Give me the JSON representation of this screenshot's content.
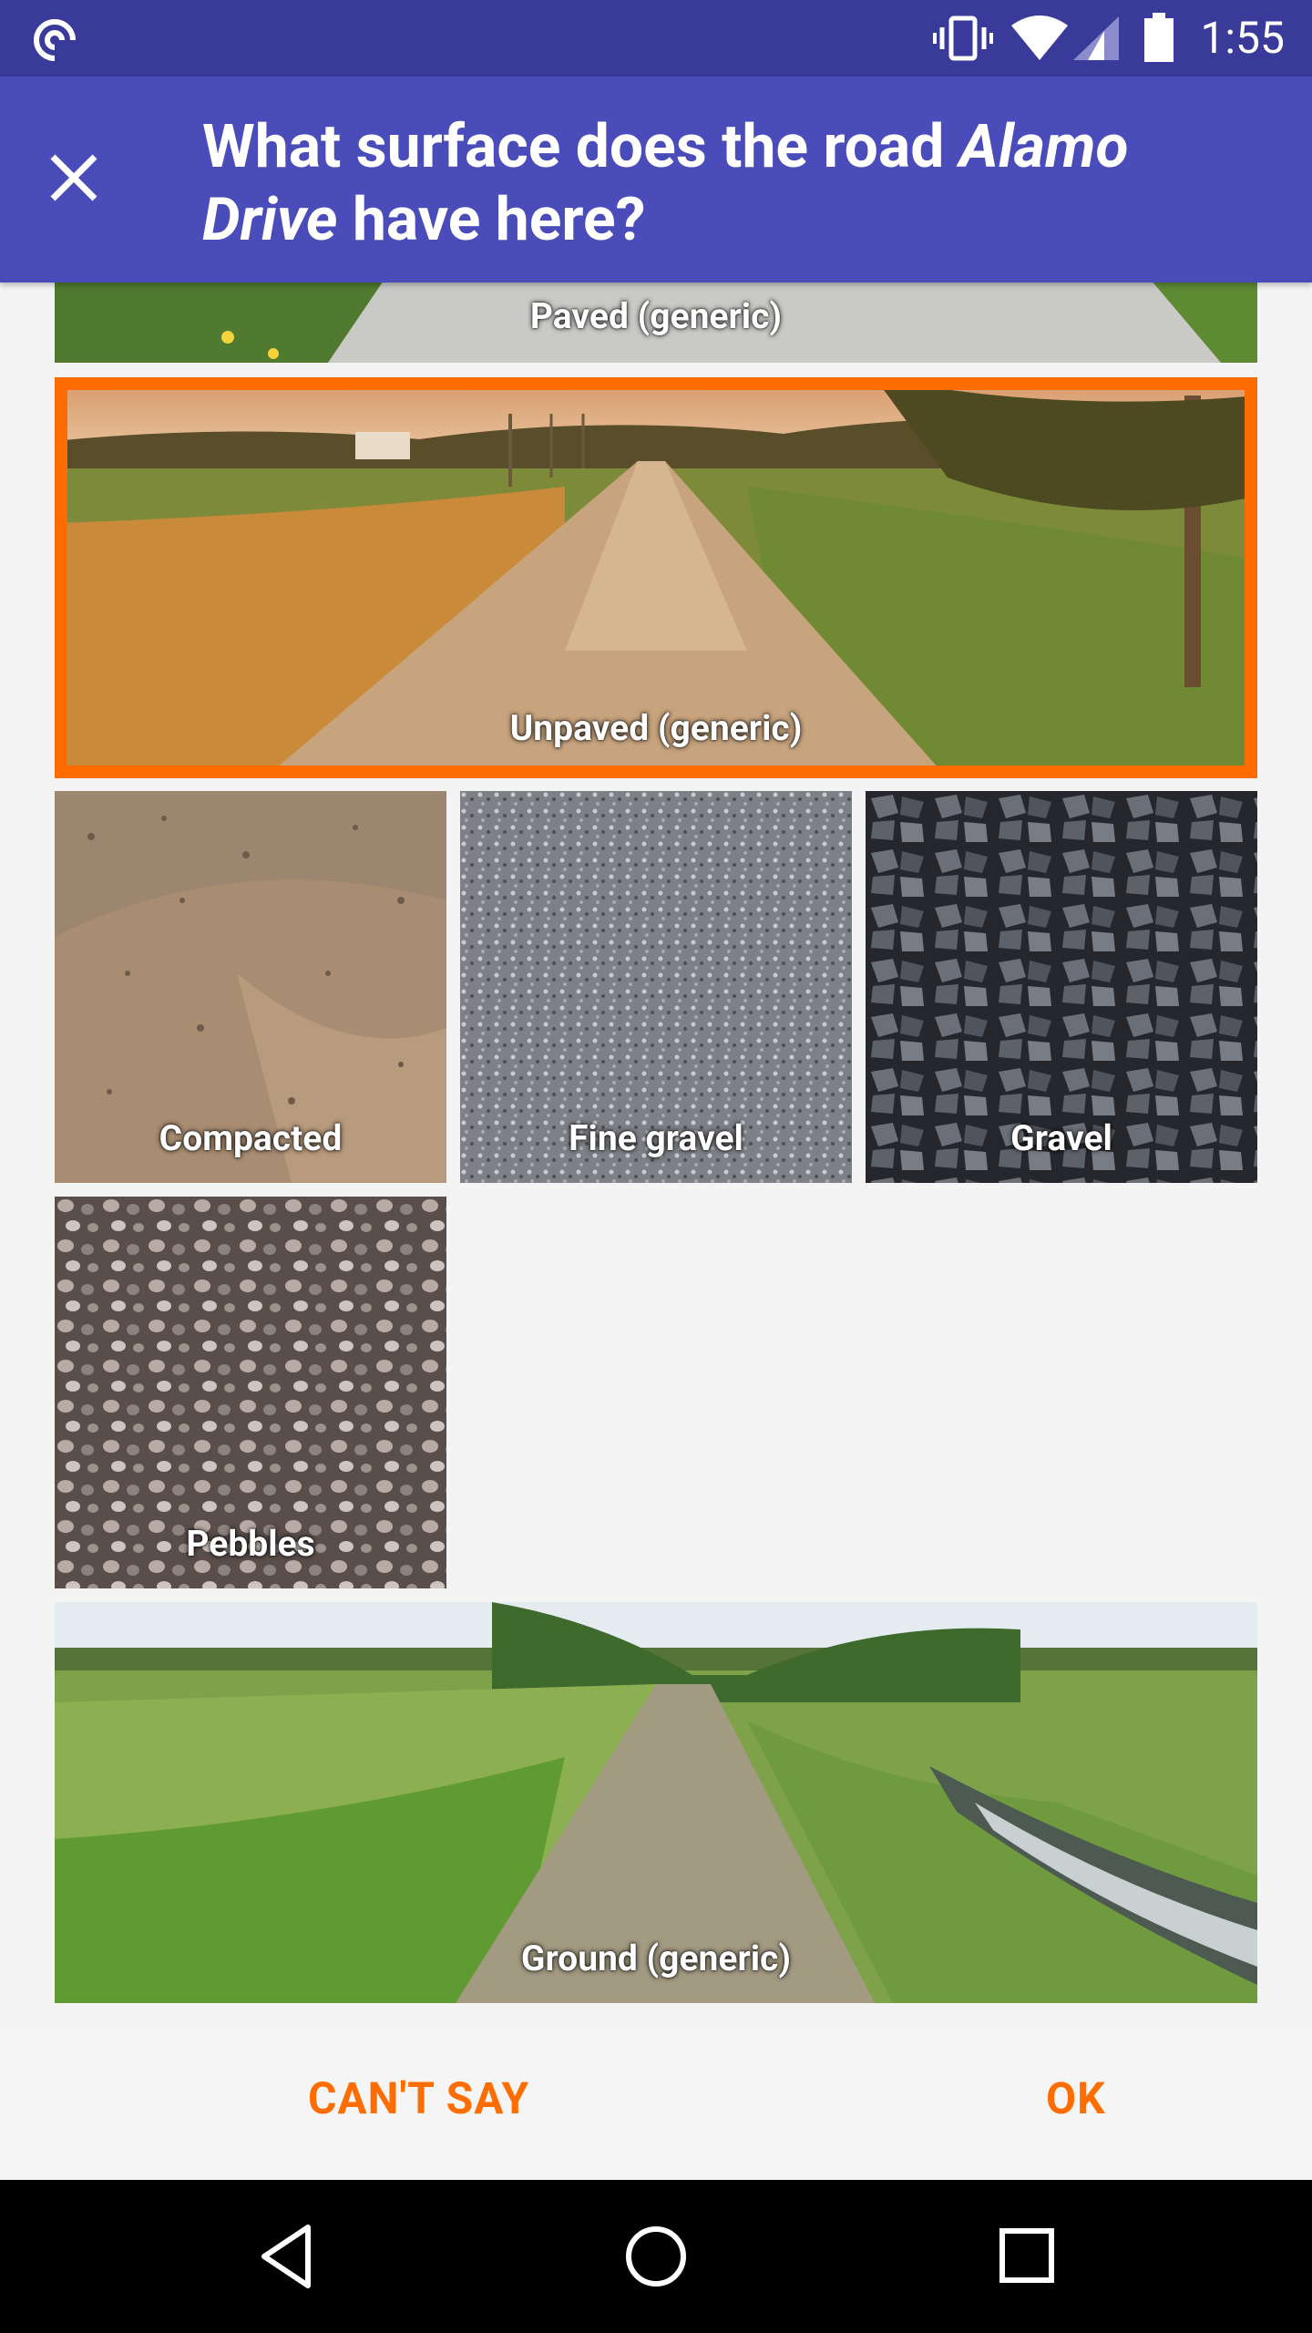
{
  "status_bar": {
    "time": "1:55",
    "icons": [
      "app-notification-icon",
      "vibrate-icon",
      "wifi-icon",
      "cellular-signal-icon",
      "battery-icon"
    ]
  },
  "header": {
    "title_part1": "What surface does the road ",
    "title_road": "Alamo Drive",
    "title_part2": " have here?",
    "close_icon": "close-icon"
  },
  "options": [
    {
      "id": "paved",
      "label": "Paved (generic)",
      "selected": false
    },
    {
      "id": "unpaved",
      "label": "Unpaved (generic)",
      "selected": true
    },
    {
      "id": "compacted",
      "label": "Compacted",
      "selected": false
    },
    {
      "id": "fine_gravel",
      "label": "Fine gravel",
      "selected": false
    },
    {
      "id": "gravel",
      "label": "Gravel",
      "selected": false
    },
    {
      "id": "pebbles",
      "label": "Pebbles",
      "selected": false
    },
    {
      "id": "ground",
      "label": "Ground (generic)",
      "selected": false
    }
  ],
  "buttons": {
    "cant_say": "CAN'T SAY",
    "ok": "OK"
  },
  "nav_bar": {
    "icons": [
      "back-icon",
      "home-icon",
      "recents-icon"
    ]
  },
  "colors": {
    "accent": "#ff6d00",
    "header": "#4a4cba",
    "status_bar": "#3a3a9a"
  }
}
